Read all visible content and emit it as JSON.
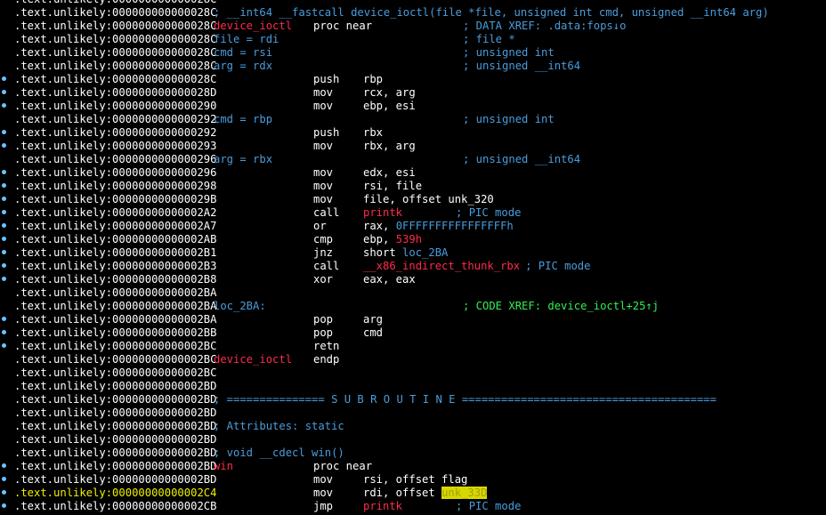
{
  "segment": ".text.unlikely",
  "rows": [
    {
      "addr": ".text.unlikely:000000000000028C",
      "full": ""
    },
    {
      "addr": ".text.unlikely:000000000000028C",
      "full": "; __int64 __fastcall device_ioctl(file *file, unsigned int cmd, unsigned __int64 arg)"
    },
    {
      "addr": ".text.unlikely:000000000000028C",
      "label": "device_ioctl",
      "mnem": "proc near",
      "cmt": "; DATA XREF: .data:fops↓o"
    },
    {
      "addr": ".text.unlikely:000000000000028C",
      "label": "file = rdi",
      "cmt": "; file *"
    },
    {
      "addr": ".text.unlikely:000000000000028C",
      "label": "cmd = rsi",
      "cmt": "; unsigned int"
    },
    {
      "addr": ".text.unlikely:000000000000028C",
      "label": "arg = rdx",
      "cmt": "; unsigned __int64"
    },
    {
      "addr": ".text.unlikely:000000000000028C",
      "mnem": "push",
      "ops": "rbp"
    },
    {
      "addr": ".text.unlikely:000000000000028D",
      "mnem": "mov",
      "ops": "rcx, arg"
    },
    {
      "addr": ".text.unlikely:0000000000000290",
      "mnem": "mov",
      "ops": "ebp, esi"
    },
    {
      "addr": ".text.unlikely:0000000000000292",
      "label": "cmd = rbp",
      "cmt": "; unsigned int"
    },
    {
      "addr": ".text.unlikely:0000000000000292",
      "mnem": "push",
      "ops": "rbx"
    },
    {
      "addr": ".text.unlikely:0000000000000293",
      "mnem": "mov",
      "ops": "rbx, arg"
    },
    {
      "addr": ".text.unlikely:0000000000000296",
      "label": "arg = rbx",
      "cmt": "; unsigned __int64"
    },
    {
      "addr": ".text.unlikely:0000000000000296",
      "mnem": "mov",
      "ops": "edx, esi"
    },
    {
      "addr": ".text.unlikely:0000000000000298",
      "mnem": "mov",
      "ops": "rsi, file"
    },
    {
      "addr": ".text.unlikely:000000000000029B",
      "mnem": "mov",
      "ops": "file, offset unk_320"
    },
    {
      "addr": ".text.unlikely:00000000000002A2",
      "mnem": "call",
      "ops_red": "printk",
      "cmt_inline": "; PIC mode"
    },
    {
      "addr": ".text.unlikely:00000000000002A7",
      "mnem": "or",
      "ops": "rax, ",
      "ops_num": "0FFFFFFFFFFFFFFFFh"
    },
    {
      "addr": ".text.unlikely:00000000000002AB",
      "mnem": "cmp",
      "ops": "ebp, ",
      "ops_redval": "539h"
    },
    {
      "addr": ".text.unlikely:00000000000002B1",
      "mnem": "jnz",
      "ops": "short ",
      "ops_num": "loc_2BA"
    },
    {
      "addr": ".text.unlikely:00000000000002B3",
      "mnem": "call",
      "ops_red": "__x86_indirect_thunk_rbx",
      "cmt_inline": "; PIC mode"
    },
    {
      "addr": ".text.unlikely:00000000000002B8",
      "mnem": "xor",
      "ops": "eax, eax"
    },
    {
      "addr": ".text.unlikely:00000000000002BA",
      "full": ""
    },
    {
      "addr": ".text.unlikely:00000000000002BA",
      "label_blue": "loc_2BA:",
      "cmt_green": "; CODE XREF: device_ioctl+25↑j"
    },
    {
      "addr": ".text.unlikely:00000000000002BA",
      "mnem": "pop",
      "ops": "arg"
    },
    {
      "addr": ".text.unlikely:00000000000002BB",
      "mnem": "pop",
      "ops": "cmd"
    },
    {
      "addr": ".text.unlikely:00000000000002BC",
      "mnem": "retn",
      "ops": ""
    },
    {
      "addr": ".text.unlikely:00000000000002BC",
      "label": "device_ioctl",
      "mnem": "endp"
    },
    {
      "addr": ".text.unlikely:00000000000002BC",
      "full": ""
    },
    {
      "addr": ".text.unlikely:00000000000002BD",
      "full": ""
    },
    {
      "addr": ".text.unlikely:00000000000002BD",
      "full": "; =============== S U B R O U T I N E ======================================="
    },
    {
      "addr": ".text.unlikely:00000000000002BD",
      "full": ""
    },
    {
      "addr": ".text.unlikely:00000000000002BD",
      "full": "; Attributes: static"
    },
    {
      "addr": ".text.unlikely:00000000000002BD",
      "full": ""
    },
    {
      "addr": ".text.unlikely:00000000000002BD",
      "full": "; void __cdecl win()"
    },
    {
      "addr": ".text.unlikely:00000000000002BD",
      "label": "win",
      "mnem": "proc near"
    },
    {
      "addr": ".text.unlikely:00000000000002BD",
      "mnem": "mov",
      "ops": "rsi, offset flag"
    },
    {
      "addr": ".text.unlikely:00000000000002C4",
      "mnem": "mov",
      "ops": "rdi, offset ",
      "ops_hl": "unk_33D",
      "highlight": true
    },
    {
      "addr": ".text.unlikely:00000000000002CB",
      "mnem": "jmp",
      "ops_red": "printk",
      "cmt_inline": "; PIC mode"
    }
  ]
}
